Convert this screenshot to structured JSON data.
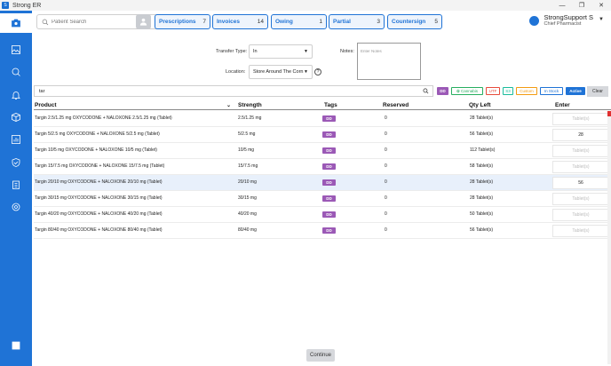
{
  "window": {
    "title": "Strong ER",
    "icon_name": "app-logo-icon"
  },
  "header": {
    "search_placeholder": "Patient Search",
    "tabs": [
      {
        "label": "Prescriptions",
        "count": "7"
      },
      {
        "label": "Invoices",
        "count": "14"
      },
      {
        "label": "Owing",
        "count": "1"
      },
      {
        "label": "Partial",
        "count": "3"
      },
      {
        "label": "Countersign",
        "count": "5"
      }
    ],
    "user": {
      "name": "StrongSupport S",
      "role": "Chief Pharmacist"
    }
  },
  "sidebar": {
    "items": [
      {
        "icon": "camera-icon",
        "active": true
      },
      {
        "icon": "image-icon",
        "active": false
      },
      {
        "icon": "search-user-icon",
        "active": false
      },
      {
        "icon": "bell-icon",
        "active": false
      },
      {
        "icon": "box-icon",
        "active": false
      },
      {
        "icon": "bar-chart-icon",
        "active": false
      },
      {
        "icon": "shield-check-icon",
        "active": false
      },
      {
        "icon": "clipboard-icon",
        "active": false
      },
      {
        "icon": "gear-icon",
        "active": false
      },
      {
        "icon": "logout-icon",
        "active": false
      }
    ]
  },
  "form": {
    "transfer_type_label": "Transfer Type:",
    "transfer_type_value": "In",
    "location_label": "Location:",
    "location_value": "Store Around The Corn",
    "notes_label": "Notes:",
    "notes_placeholder": "Enter Notes"
  },
  "filter": {
    "query": "tar",
    "chips": {
      "dd": "DD",
      "cannabis": "Cannabis",
      "utf": "UTF",
      "s3": "S3",
      "custom": "Custom",
      "instock": "In Stock",
      "active": "Active"
    },
    "clear_label": "Clear"
  },
  "table": {
    "columns": [
      "Product",
      "Strength",
      "Tags",
      "Reserved",
      "Qty Left",
      "Enter"
    ],
    "enter_placeholder": "Tablet(s)",
    "rows": [
      {
        "product": "Targin 2.5/1.25 mg OXYCODONE + NALOXONE 2.5/1.25 mg (Tablet)",
        "strength": "2.5/1.25 mg",
        "tag": "DD",
        "reserved": "0",
        "qty": "28 Tablet(s)",
        "enter": ""
      },
      {
        "product": "Targin 5/2.5 mg OXYCODONE + NALOXONE 5/2.5 mg (Tablet)",
        "strength": "5/2.5 mg",
        "tag": "DD",
        "reserved": "0",
        "qty": "56 Tablet(s)",
        "enter": "28"
      },
      {
        "product": "Targin 10/5 mg OXYCODONE + NALOXONE 10/5 mg (Tablet)",
        "strength": "10/5 mg",
        "tag": "DD",
        "reserved": "0",
        "qty": "112 Tablet(s)",
        "enter": ""
      },
      {
        "product": "Targin 15/7.5 mg OXYCODONE + NALOXONE 15/7.5 mg (Tablet)",
        "strength": "15/7.5 mg",
        "tag": "DD",
        "reserved": "0",
        "qty": "58 Tablet(s)",
        "enter": ""
      },
      {
        "product": "Targin 20/10 mg OXYCODONE + NALOXONE 20/10 mg (Tablet)",
        "strength": "20/10 mg",
        "tag": "DD",
        "reserved": "0",
        "qty": "28 Tablet(s)",
        "enter": "56"
      },
      {
        "product": "Targin 30/15 mg OXYCODONE + NALOXONE 30/15 mg (Tablet)",
        "strength": "30/15 mg",
        "tag": "DD",
        "reserved": "0",
        "qty": "28 Tablet(s)",
        "enter": ""
      },
      {
        "product": "Targin 40/20 mg OXYCODONE + NALOXONE 40/20 mg (Tablet)",
        "strength": "40/20 mg",
        "tag": "DD",
        "reserved": "0",
        "qty": "50 Tablet(s)",
        "enter": ""
      },
      {
        "product": "Targin 80/40 mg OXYCODONE + NALOXONE 80/40 mg (Tablet)",
        "strength": "80/40 mg",
        "tag": "DD",
        "reserved": "0",
        "qty": "56 Tablet(s)",
        "enter": ""
      }
    ]
  },
  "footer": {
    "continue_label": "Continue"
  },
  "colors": {
    "primary": "#1f73d6",
    "tag_dd": "#9b59b6",
    "cannabis": "#27ae60",
    "utf": "#e74c3c",
    "s3": "#1abc9c",
    "custom": "#f39c12"
  }
}
